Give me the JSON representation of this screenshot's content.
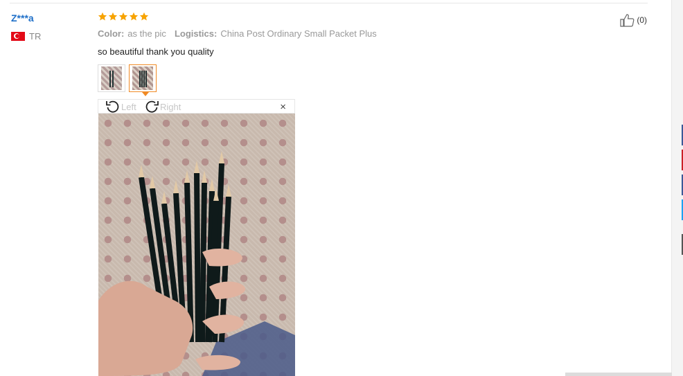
{
  "review": {
    "user_name": "Z***a",
    "country_code": "TR",
    "rating": 5,
    "helpful_count": "(0)",
    "color_label": "Color:",
    "color_value": "as the pic",
    "logistics_label": "Logistics:",
    "logistics_value": "China Post Ordinary Small Packet Plus",
    "text": "so beautiful thank you quality"
  },
  "viewer": {
    "rotate_left_label": "Left",
    "rotate_right_label": "Right",
    "close_label": "×"
  },
  "icons": {
    "star": "star-icon",
    "thumb_up": "thumbs-up-icon",
    "rotate_left": "rotate-left-icon",
    "rotate_right": "rotate-right-icon",
    "close": "close-icon",
    "flag": "turkey-flag-icon"
  },
  "colors": {
    "user_link": "#1e6fc8",
    "star": "#f7a300",
    "active_thumb_border": "#f08a24"
  }
}
